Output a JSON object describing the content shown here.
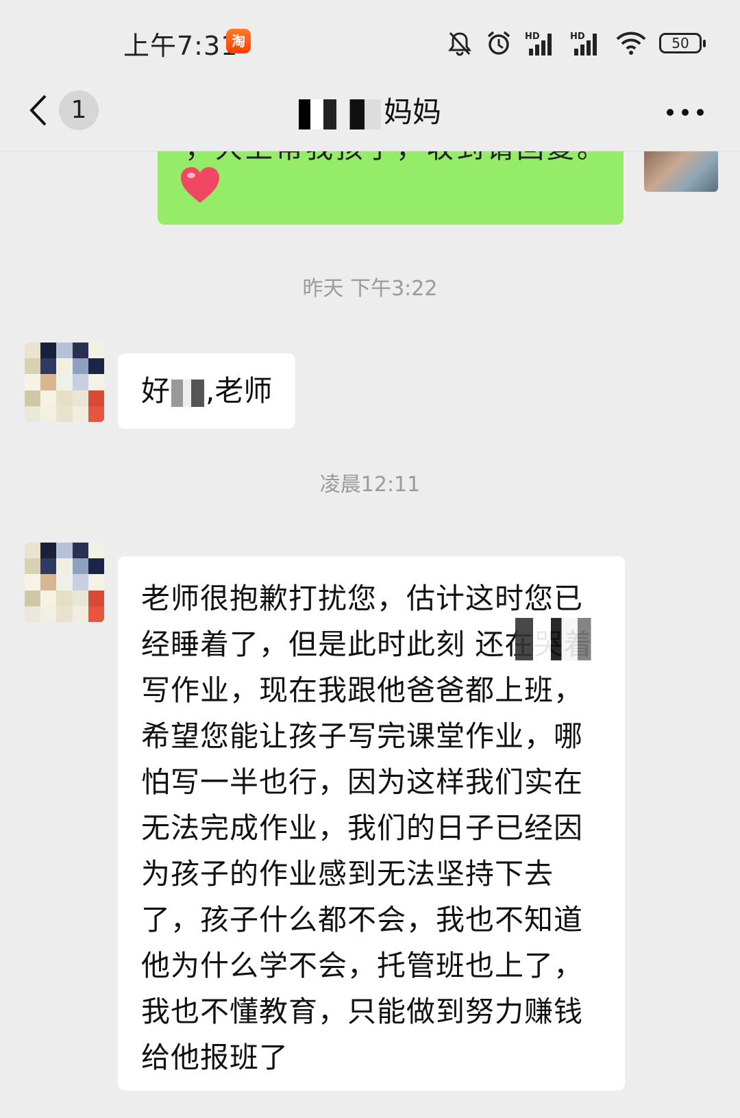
{
  "status_bar": {
    "time": "上午7:31",
    "taobao_icon_label": "淘",
    "battery_level": "50",
    "signal_label_1": "HD",
    "signal_label_2": "HD"
  },
  "header": {
    "back_count": "1",
    "contact_suffix": "妈妈"
  },
  "messages": {
    "sent_fragment": "，大上帮我孩子，收到请回复。",
    "timestamp_1": "昨天 下午3:22",
    "greeting_prefix": "好",
    "greeting_suffix": ",老师",
    "timestamp_2": "凌晨12:11",
    "long_message": "老师很抱歉打扰您，估计这时您已经睡着了，但是此时此刻 还在哭着写作业，现在我跟他爸爸都上班，希望您能让孩子写完课堂作业，哪怕写一半也行，因为这样我们实在无法完成作业，我们的日子已经因为孩子的作业感到无法坚持下去了，孩子什么都不会，我也不知道他为什么学不会，托管班也上了，我也不懂教育，只能做到努力赚钱给他报班了"
  },
  "icons": [
    "bell-muted-icon",
    "alarm-icon",
    "signal-icon",
    "wifi-icon",
    "battery-icon",
    "chevron-left-icon",
    "more-icon",
    "heart-icon",
    "taobao-icon"
  ],
  "colors": {
    "background": "#ededed",
    "sent_bubble": "#95ec69",
    "received_bubble": "#ffffff",
    "timestamp_text": "#9a9a9a"
  }
}
